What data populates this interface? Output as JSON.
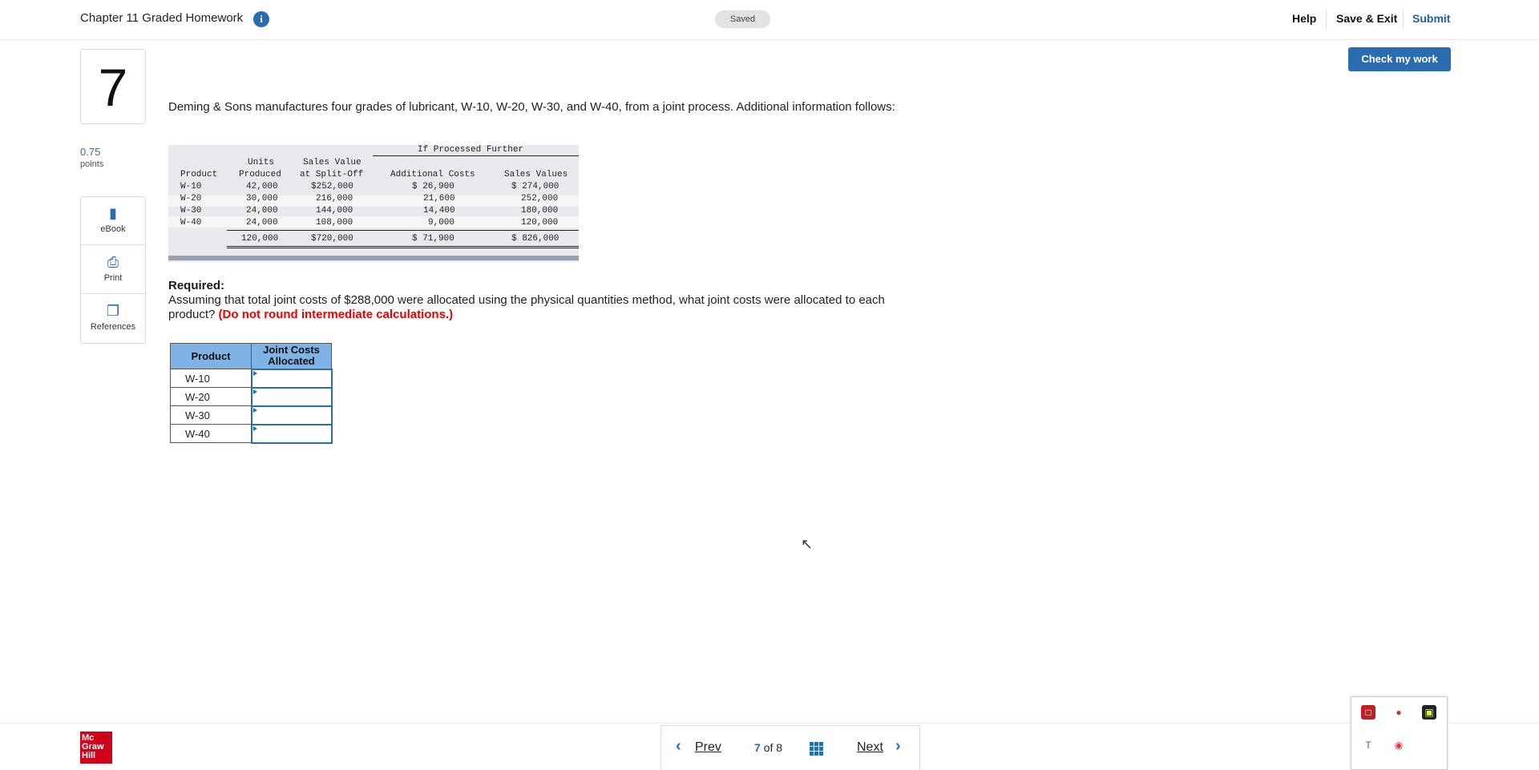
{
  "header": {
    "title": "Chapter 11 Graded Homework",
    "saved": "Saved",
    "help": "Help",
    "save_exit": "Save & Exit",
    "submit": "Submit",
    "check_work": "Check my work"
  },
  "question": {
    "number": "7",
    "points": "0.75",
    "points_label": "points",
    "intro": "Deming & Sons manufactures four grades of lubricant, W-10, W-20, W-30, and W-40, from a joint process. Additional information follows:",
    "required_heading": "Required:",
    "required_text": "Assuming that total joint costs of $288,000 were allocated using the physical quantities method, what joint costs were allocated to each product?",
    "required_note": "(Do not round intermediate calculations.)"
  },
  "tools": {
    "ebook": "eBook",
    "print": "Print",
    "references": "References"
  },
  "data_table": {
    "group_header": "If Processed Further",
    "h_units_1": "Units",
    "h_units_2": "Produced",
    "h_sv_1": "Sales Value",
    "h_sv_2": "at Split-Off",
    "h_product": "Product",
    "h_addl": "Additional Costs",
    "h_sales": "Sales Values",
    "rows": [
      {
        "product": "W-10",
        "units": "42,000",
        "split": "$252,000",
        "addl": "$ 26,900",
        "sales": "$ 274,000"
      },
      {
        "product": "W-20",
        "units": "30,000",
        "split": "216,000",
        "addl": "21,600",
        "sales": "252,000"
      },
      {
        "product": "W-30",
        "units": "24,000",
        "split": "144,000",
        "addl": "14,400",
        "sales": "180,000"
      },
      {
        "product": "W-40",
        "units": "24,000",
        "split": "108,000",
        "addl": "9,000",
        "sales": "120,000"
      }
    ],
    "totals": {
      "units": "120,000",
      "split": "$720,000",
      "addl": "$ 71,900",
      "sales": "$ 826,000"
    }
  },
  "answer_table": {
    "h_product": "Product",
    "h_joint": "Joint Costs Allocated",
    "rows": [
      "W-10",
      "W-20",
      "W-30",
      "W-40"
    ]
  },
  "footer": {
    "logo": "Mc Graw Hill",
    "prev": "Prev",
    "current": "7",
    "of": "of",
    "total": "8",
    "next": "Next"
  }
}
